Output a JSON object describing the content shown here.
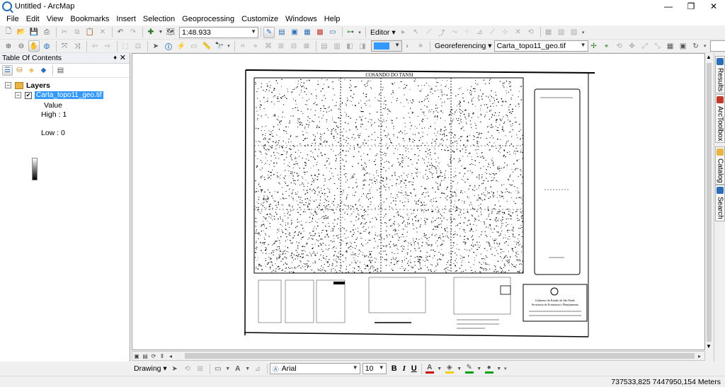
{
  "window": {
    "title": "Untitled - ArcMap",
    "minimize": "—",
    "maximize": "❐",
    "close": "✕"
  },
  "menu": [
    "File",
    "Edit",
    "View",
    "Bookmarks",
    "Insert",
    "Selection",
    "Geoprocessing",
    "Customize",
    "Windows",
    "Help"
  ],
  "toolbar": {
    "scale": "1:48.933",
    "editor": "Editor ▾",
    "georeferencing": "Georeferencing ▾",
    "georef_layer": "Carta_topo11_geo.tif",
    "georef_input": ""
  },
  "toc": {
    "title": "Table Of Contents",
    "pin": "♦",
    "close": "✕",
    "root": "Layers",
    "layer_name": "Carta_topo11_geo.tif",
    "legend_heading": "Value",
    "high_label": "High : 1",
    "low_label": "Low : 0"
  },
  "map": {
    "sheet_title": "COSANDO DO TANSI",
    "title_block_text": [
      "Gobierno do Estado de São Paulo",
      "Secretaria de Economia e Planejamento"
    ]
  },
  "right_dock": [
    "Results",
    "ArcToolbox",
    "Catalog",
    "Search"
  ],
  "drawing": {
    "label": "Drawing ▾",
    "font": "Arial",
    "size": "10",
    "bold": "B",
    "italic": "I",
    "underline": "U",
    "font_color_letter": "A"
  },
  "colors": {
    "selection_highlight": "#3399ff",
    "font_color_underline": "#cc0000",
    "fill_color_underline": "#f0d000",
    "line_color_underline": "#00a000"
  },
  "status": {
    "coordinates": "737533,825  7447950,154 Meters"
  }
}
